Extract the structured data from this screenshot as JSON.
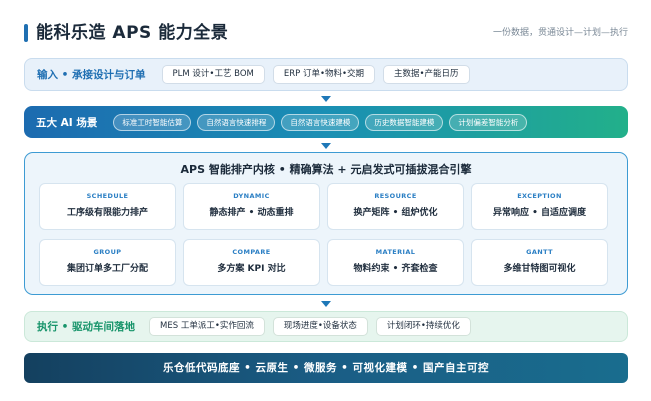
{
  "header": {
    "title": "能科乐造 APS 能力全景",
    "subtitle": "一份数据，贯通设计—计划—执行"
  },
  "input": {
    "label": "输入 • 承接设计与订单",
    "chips": [
      "PLM 设计•工艺 BOM",
      "ERP 订单•物料•交期",
      "主数据•产能日历"
    ]
  },
  "ai": {
    "label": "五大 AI 场景",
    "chips": [
      "标准工时智能估算",
      "自然语言快速排程",
      "自然语言快速建模",
      "历史数据智能建模",
      "计划偏差智能分析"
    ]
  },
  "engine": {
    "title": "APS 智能排产内核 • 精确算法 + 元启发式可插拔混合引擎",
    "cards": [
      {
        "en": "SCHEDULE",
        "zh": "工序级有限能力排产"
      },
      {
        "en": "DYNAMIC",
        "zh": "静态排产 • 动态重排"
      },
      {
        "en": "RESOURCE",
        "zh": "换产矩阵 • 组炉优化"
      },
      {
        "en": "EXCEPTION",
        "zh": "异常响应 • 自适应调度"
      },
      {
        "en": "GROUP",
        "zh": "集团订单多工厂分配"
      },
      {
        "en": "COMPARE",
        "zh": "多方案 KPI 对比"
      },
      {
        "en": "MATERIAL",
        "zh": "物料约束 • 齐套检查"
      },
      {
        "en": "GANTT",
        "zh": "多维甘特图可视化"
      }
    ]
  },
  "execute": {
    "label": "执行 • 驱动车间落地",
    "chips": [
      "MES 工单派工•实作回流",
      "现场进度•设备状态",
      "计划闭环•持续优化"
    ]
  },
  "footer": {
    "text": "乐仓低代码底座  •  云原生 • 微服务 • 可视化建模 • 国产自主可控"
  }
}
